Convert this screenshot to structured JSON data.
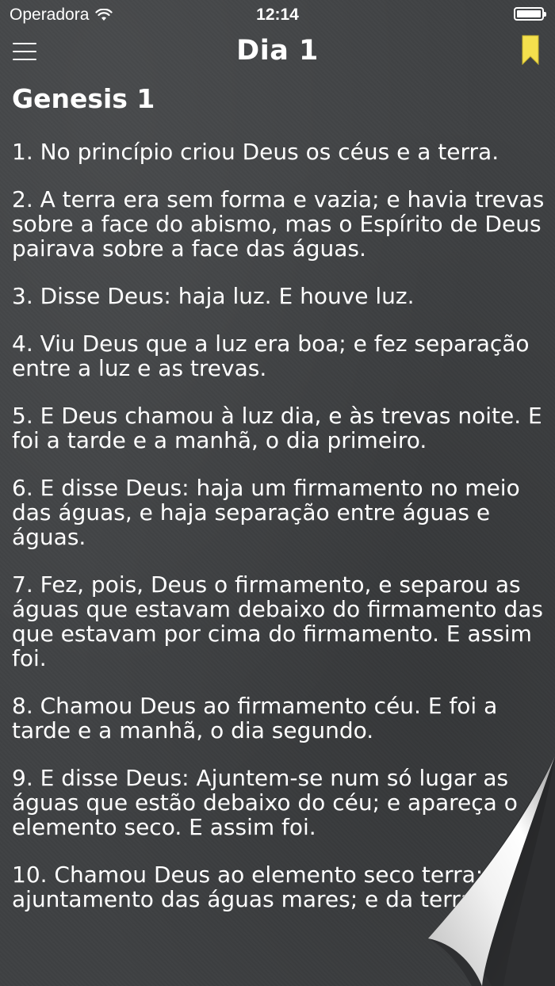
{
  "status_bar": {
    "carrier": "Operadora",
    "time": "12:14"
  },
  "nav": {
    "title": "Dia 1"
  },
  "chapter": {
    "title": "Genesis 1",
    "verses": [
      "1. No princípio criou Deus os céus e a terra.",
      "2. A terra era sem forma e vazia; e havia trevas sobre a face do abismo, mas o Espírito de Deus pairava sobre a face das águas.",
      "3. Disse Deus: haja luz. E houve luz.",
      "4. Viu Deus que a luz era boa; e fez separação entre a luz e as trevas.",
      "5. E Deus chamou à luz dia, e às trevas noite. E foi a tarde e a manhã, o dia primeiro.",
      "6. E disse Deus: haja um firmamento no meio das águas, e haja separação entre águas e águas.",
      "7. Fez, pois, Deus o firmamento, e separou as águas que estavam debaixo do firmamento das que estavam por cima do firmamento. E assim foi.",
      "8. Chamou Deus ao firmamento céu. E foi a tarde e a manhã, o dia segundo.",
      "9. E disse Deus: Ajuntem-se num só lugar as águas que estão debaixo do céu; e apareça o elemento seco. E assim foi.",
      "10. Chamou Deus ao elemento seco terra; e ao ajuntamento das águas mares; e da terra toda"
    ]
  },
  "colors": {
    "background": "#3f4143",
    "text": "#ffffff",
    "bookmark": "#f4e04d"
  },
  "icons": [
    "menu-icon",
    "bookmark-icon",
    "wifi-icon",
    "battery-icon"
  ]
}
